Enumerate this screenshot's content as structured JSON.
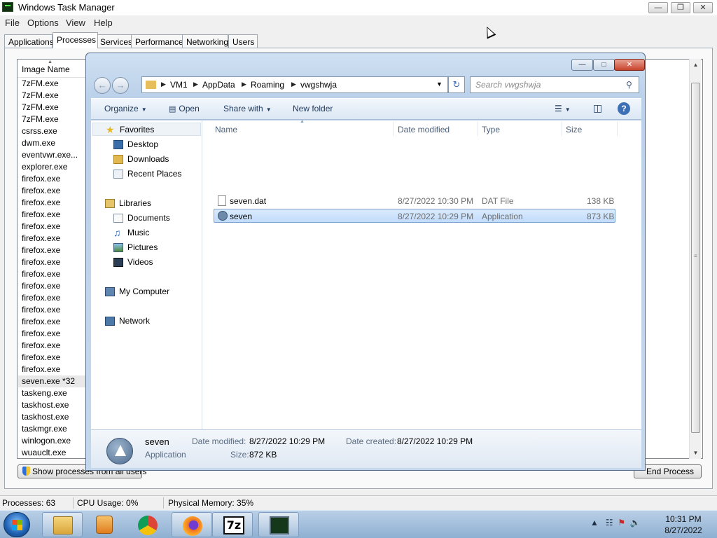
{
  "taskmgr": {
    "title": "Windows Task Manager",
    "menu": [
      "File",
      "Options",
      "View",
      "Help"
    ],
    "tabs": [
      "Applications",
      "Processes",
      "Services",
      "Performance",
      "Networking",
      "Users"
    ],
    "active_tab": "Processes",
    "column_header": "Image Name",
    "processes": [
      "7zFM.exe",
      "7zFM.exe",
      "7zFM.exe",
      "7zFM.exe",
      "csrss.exe",
      "dwm.exe",
      "eventvwr.exe...",
      "explorer.exe",
      "firefox.exe",
      "firefox.exe",
      "firefox.exe",
      "firefox.exe",
      "firefox.exe",
      "firefox.exe",
      "firefox.exe",
      "firefox.exe",
      "firefox.exe",
      "firefox.exe",
      "firefox.exe",
      "firefox.exe",
      "firefox.exe",
      "firefox.exe",
      "firefox.exe",
      "firefox.exe",
      "firefox.exe",
      "seven.exe *32",
      "taskeng.exe",
      "taskhost.exe",
      "taskhost.exe",
      "taskmgr.exe",
      "winlogon.exe",
      "wuauclt.exe"
    ],
    "selected_process": "seven.exe *32",
    "show_all_button": "Show processes from all users",
    "end_process_button": "End Process",
    "status": {
      "processes": "Processes: 63",
      "cpu": "CPU Usage: 0%",
      "memory": "Physical Memory: 35%"
    }
  },
  "explorer": {
    "breadcrumb": [
      "VM1",
      "AppData",
      "Roaming",
      "vwgshwja"
    ],
    "search_placeholder": "Search vwgshwja",
    "commands": {
      "organize": "Organize",
      "open": "Open",
      "share_with": "Share with",
      "new_folder": "New folder"
    },
    "nav": {
      "favorites": "Favorites",
      "desktop": "Desktop",
      "downloads": "Downloads",
      "recent_places": "Recent Places",
      "libraries": "Libraries",
      "documents": "Documents",
      "music": "Music",
      "pictures": "Pictures",
      "videos": "Videos",
      "my_computer": "My Computer",
      "network": "Network"
    },
    "columns": {
      "name": "Name",
      "date_modified": "Date modified",
      "type": "Type",
      "size": "Size"
    },
    "files": [
      {
        "name": "seven.dat",
        "date": "8/27/2022 10:30 PM",
        "type": "DAT File",
        "size": "138 KB",
        "icon": "document-icon"
      },
      {
        "name": "seven",
        "date": "8/27/2022 10:29 PM",
        "type": "Application",
        "size": "873 KB",
        "icon": "application-icon"
      }
    ],
    "selected_file": "seven",
    "details": {
      "name": "seven",
      "type": "Application",
      "date_modified_label": "Date modified:",
      "date_modified": "8/27/2022 10:29 PM",
      "size_label": "Size:",
      "size": "872 KB",
      "date_created_label": "Date created:",
      "date_created": "8/27/2022 10:29 PM"
    }
  },
  "taskbar": {
    "apps": [
      "windows-explorer-icon",
      "media-player-icon",
      "chrome-icon",
      "firefox-icon",
      "7zip-icon",
      "task-manager-icon"
    ],
    "zip_label": "7z",
    "time": "10:31 PM",
    "date": "8/27/2022"
  },
  "colors": {
    "selection": "#c1dcfc",
    "explorer_frame": "#bcd2ea",
    "taskbar": "#8fb0d2"
  }
}
